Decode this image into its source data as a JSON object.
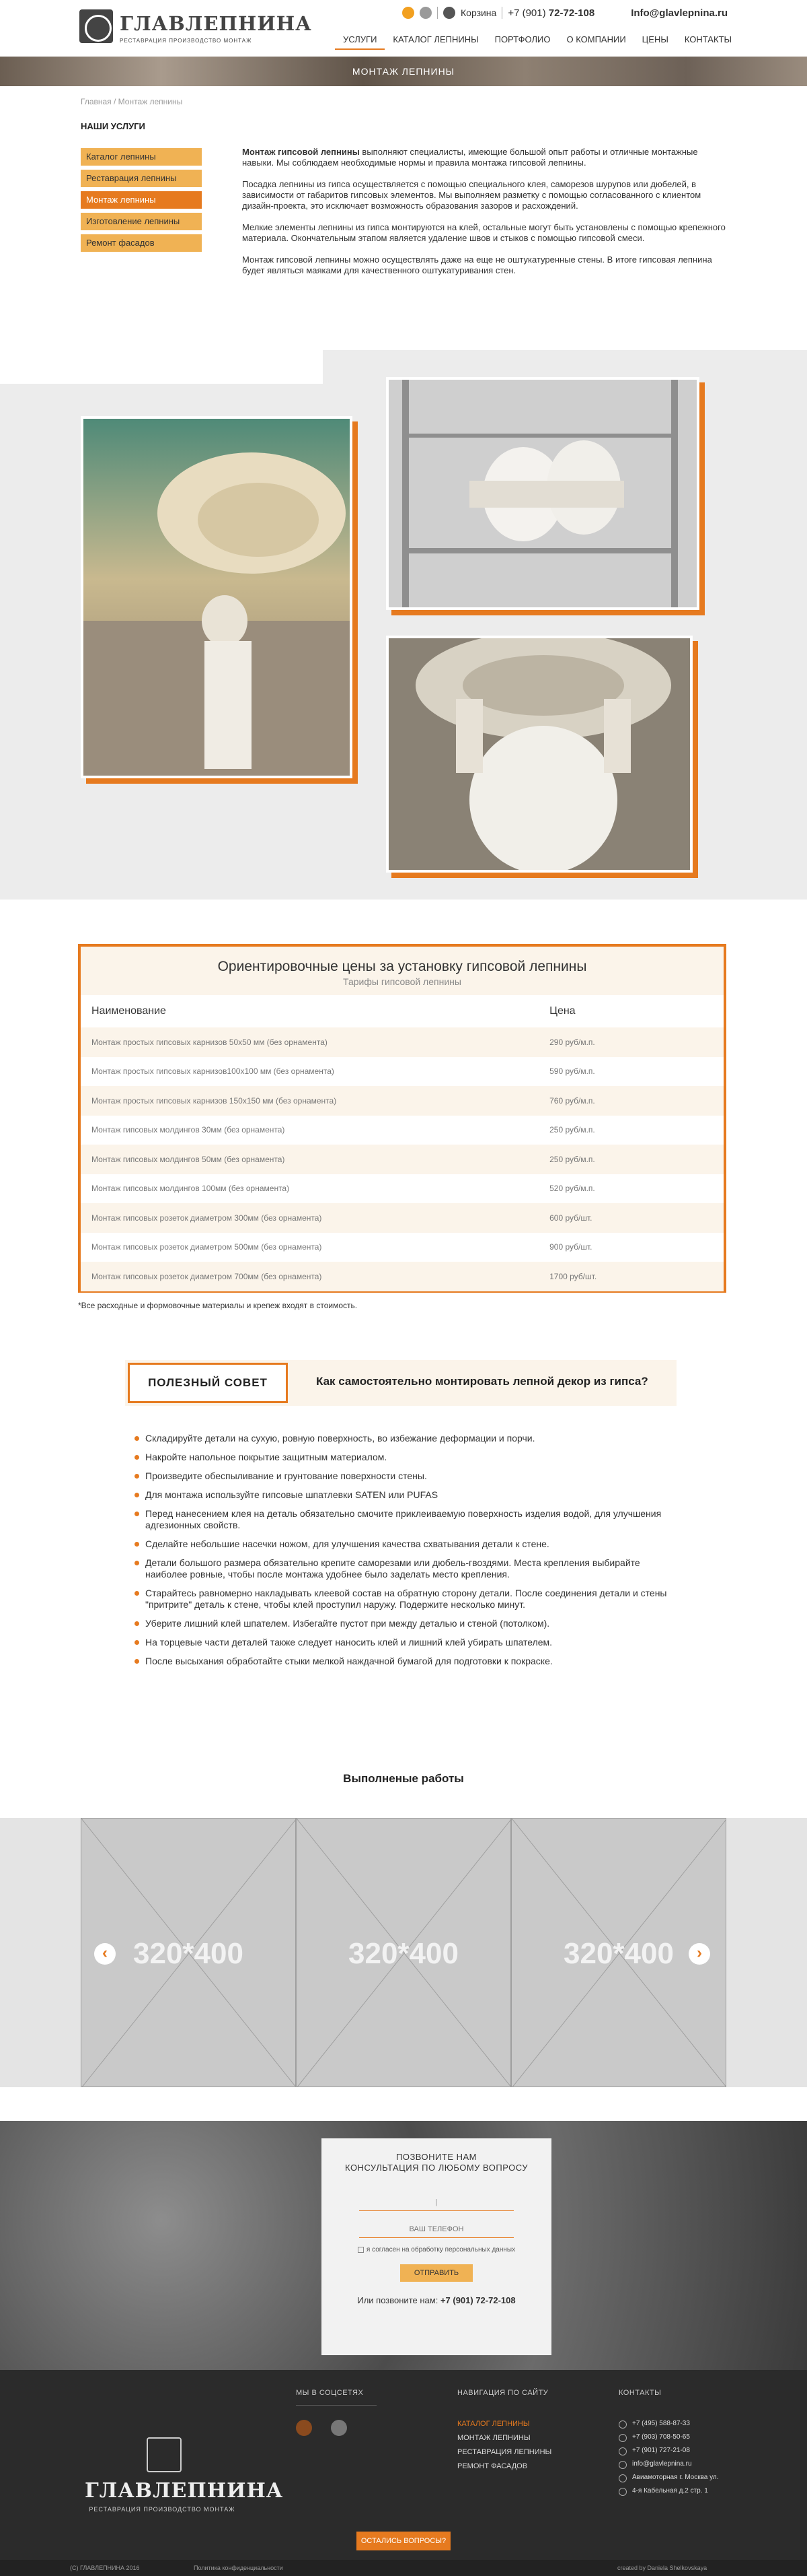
{
  "header": {
    "logo_name": "ГЛАВЛЕПНИНА",
    "logo_sub": "РЕСТАВРАЦИЯ ПРОИЗВОДСТВО МОНТАЖ",
    "cart_label": "Корзина",
    "phone_prefix": "+7 (901)",
    "phone_main": "72-72-108",
    "email": "Info@glavlepnina.ru",
    "nav": [
      "УСЛУГИ",
      "КАТАЛОГ ЛЕПНИНЫ",
      "ПОРТФОЛИО",
      "О КОМПАНИИ",
      "ЦЕНЫ",
      "КОНТАКТЫ"
    ],
    "active_nav": "УСЛУГИ"
  },
  "banner": {
    "title": "МОНТАЖ ЛЕПНИНЫ"
  },
  "breadcrumb": "Главная / Монтаж лепнины",
  "sidebar": {
    "title": "НАШИ УСЛУГИ",
    "items": [
      "Каталог лепнины",
      "Реставрация лепнины",
      "Монтаж лепнины",
      "Изготовление лепнины",
      "Ремонт фасадов"
    ],
    "active": "Монтаж лепнины"
  },
  "intro": {
    "p1_bold": "Монтаж гипсовой лепнины",
    "p1": " выполняют специалисты, имеющие большой опыт работы и отличные монтажные навыки. Мы соблюдаем необходимые нормы и правила монтажа гипсовой лепнины.",
    "p2": "Посадка лепнины из гипса осуществляется с помощью специального клея, саморезов шурупов или дюбелей, в зависимости от габаритов гипсовых элементов. Мы выполняем разметку с помощью согласованного с клиентом дизайн-проекта, это исключает возможность образования зазоров и расхождений.",
    "p3": "Мелкие элементы лепнины из гипса монтируются на клей, остальные могут быть установлены с помощью крепежного материала. Окончательным этапом является удаление швов и стыков с помощью гипсовой смеси.",
    "p4": "Монтаж гипсовой лепнины можно осуществлять даже на еще не оштукатуренные стены. В итоге гипсовая лепнина будет являться маяками для качественного оштукатуривания стен."
  },
  "price": {
    "title": "Ориентировочные цены за установку гипсовой лепнины",
    "subtitle": "Тарифы гипсовой лепнины",
    "col_name": "Наименование",
    "col_price": "Цена",
    "rows": [
      {
        "name": "Монтаж простых гипсовых карнизов 50х50 мм (без орнамента)",
        "price": "290 руб/м.п."
      },
      {
        "name": "Монтаж простых гипсовых карнизов100х100 мм (без орнамента)",
        "price": "590 руб/м.п."
      },
      {
        "name": "Монтаж простых гипсовых карнизов 150х150 мм (без орнамента)",
        "price": "760 руб/м.п."
      },
      {
        "name": "Монтаж гипсовых молдингов 30мм (без орнамента)",
        "price": "250 руб/м.п."
      },
      {
        "name": "Монтаж гипсовых молдингов 50мм (без орнамента)",
        "price": "250 руб/м.п."
      },
      {
        "name": "Монтаж гипсовых молдингов 100мм (без орнамента)",
        "price": "520 руб/м.п."
      },
      {
        "name": "Монтаж гипсовых розеток диаметром 300мм (без орнамента)",
        "price": "600 руб/шт."
      },
      {
        "name": "Монтаж гипсовых розеток диаметром 500мм (без орнамента)",
        "price": "900 руб/шт."
      },
      {
        "name": "Монтаж гипсовых розеток диаметром 700мм (без орнамента)",
        "price": "1700 руб/шт."
      }
    ],
    "note": "*Все расходные и формовочные материалы и крепеж входят в стоимость."
  },
  "advice": {
    "label": "ПОЛЕЗНЫЙ СОВЕТ",
    "title": "Как самостоятельно монтировать лепной декор из гипса?",
    "tips": [
      "Складируйте детали на сухую, ровную поверхность, во избежание деформации и порчи.",
      "Накройте напольное покрытие защитным материалом.",
      "Произведите обеспыливание и грунтование поверхности стены.",
      "Для монтажа используйте гипсовые шпатлевки SATEN или PUFAS",
      "Перед нанесением клея на деталь обязательно смочите приклеиваемую поверхность изделия водой, для улучшения адгезионных свойств.",
      "Сделайте небольшие насечки ножом, для улучшения качества схватывания детали к стене.",
      "Детали большого размера обязательно крепите саморезами или дюбель-гвоздями. Места крепления выбирайте наиболее ровные, чтобы после монтажа удобнее было заделать место крепления.",
      "Старайтесь равномерно накладывать клеевой состав на обратную сторону детали. После соединения детали и стены \"притрите\" деталь к стене, чтобы клей проступил наружу. Подержите несколько минут.",
      "Уберите лишний клей шпателем. Избегайте пустот при между деталью и стеной (потолком).",
      "На торцевые части деталей также следует наносить клей и лишний клей убирать шпателем.",
      "После высыхания обработайте стыки мелкой наждачной бумагой для подготовки к покраске."
    ]
  },
  "works": {
    "title": "Выполненые работы",
    "slides": [
      "320*400",
      "320*400",
      "320*400"
    ],
    "prev": "‹",
    "next": "›"
  },
  "form": {
    "title_line1": "ПОЗВОНИТЕ НАМ",
    "title_line2": "КОНСУЛЬТАЦИЯ ПО ЛЮБОМУ ВОПРОСУ",
    "name_value": "|",
    "phone_placeholder": "ВАШ ТЕЛЕФОН",
    "consent": "я согласен на обработку персональных данных",
    "submit": "ОТПРАВИТЬ",
    "or_call": "Или позвоните нам:",
    "or_call_phone": "+7 (901) 72-72-108"
  },
  "footer": {
    "logo_name": "ГЛАВЛЕПНИНА",
    "logo_sub": "РЕСТАВРАЦИЯ ПРОИЗВОДСТВО МОНТАЖ",
    "social_title": "МЫ В СОЦСЕТЯХ",
    "nav_title": "НАВИГАЦИЯ ПО САЙТУ",
    "nav": [
      "КАТАЛОГ ЛЕПНИНЫ",
      "МОНТАЖ ЛЕПНИНЫ",
      "РЕСТАВРАЦИЯ ЛЕПНИНЫ",
      "РЕМОНТ ФАСАДОВ"
    ],
    "contacts_title": "КОНТАКТЫ",
    "contacts": [
      "+7 (495) 588-87-33",
      "+7 (903) 708-50-65",
      "+7 (901) 727-21-08",
      "info@glavlepnina.ru",
      "Авиамоторная г. Москва ул.",
      "4-я Кабельная д.2 стр. 1"
    ],
    "button": "ОСТАЛИСЬ ВОПРОСЫ?",
    "copyright": "(C) ГЛАВЛЕПНИНА 2016",
    "policy": "Политика конфиденциальности",
    "credit": "created by Daniela Shelkovskaya"
  },
  "colors": {
    "accent": "#e67a1f",
    "accent_light": "#f0b254",
    "cream": "#fbf4ea",
    "footer": "#2b2b2b"
  }
}
